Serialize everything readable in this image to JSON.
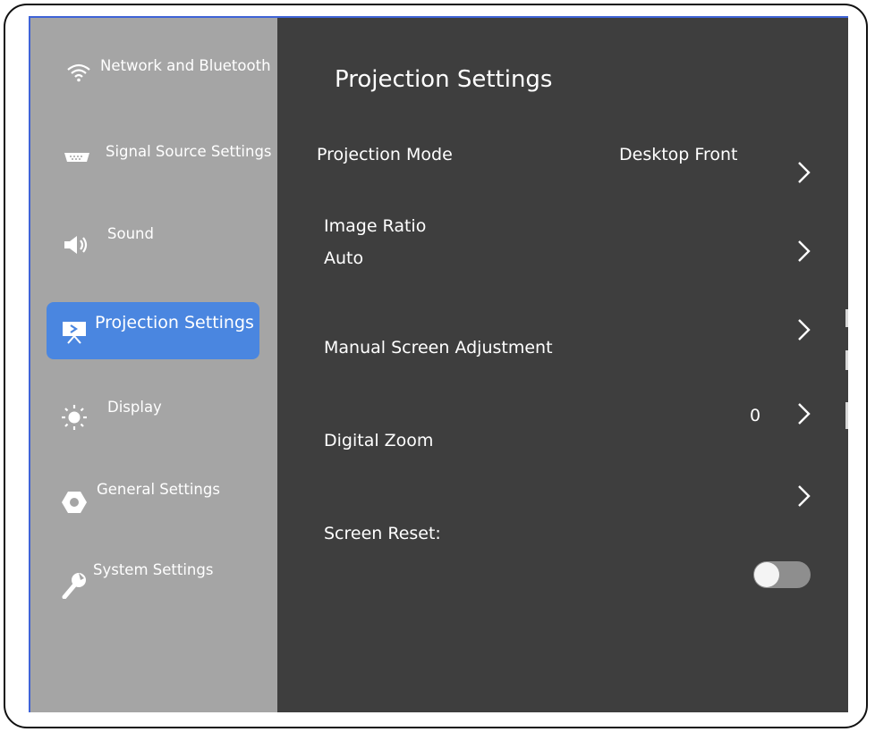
{
  "sidebar": {
    "items": [
      {
        "label": "Network and Bluetooth",
        "icon": "wifi-icon"
      },
      {
        "label": "Signal Source Settings",
        "icon": "signal-source-icon"
      },
      {
        "label": "Sound",
        "icon": "speaker-icon"
      },
      {
        "label": "Projection Settings",
        "icon": "projector-icon",
        "active": true
      },
      {
        "label": "Display",
        "icon": "brightness-icon"
      },
      {
        "label": "General Settings",
        "icon": "hexagon-gear-icon"
      },
      {
        "label": "System Settings",
        "icon": "wrench-icon"
      }
    ]
  },
  "main": {
    "title": "Projection Settings",
    "rows": [
      {
        "label": "Projection Mode",
        "value": "Desktop Front"
      },
      {
        "label": "Image Ratio",
        "value": "Auto"
      },
      {
        "label": "Manual Screen Adjustment"
      },
      {
        "label": "Digital Zoom",
        "value": "0"
      },
      {
        "label": "Screen Reset:"
      }
    ],
    "toggle_on": false
  },
  "colors": {
    "sidebar_bg": "#a5a5a5",
    "main_bg": "#3e3e3e",
    "active_bg": "#4a86e0",
    "text": "#ffffff"
  }
}
